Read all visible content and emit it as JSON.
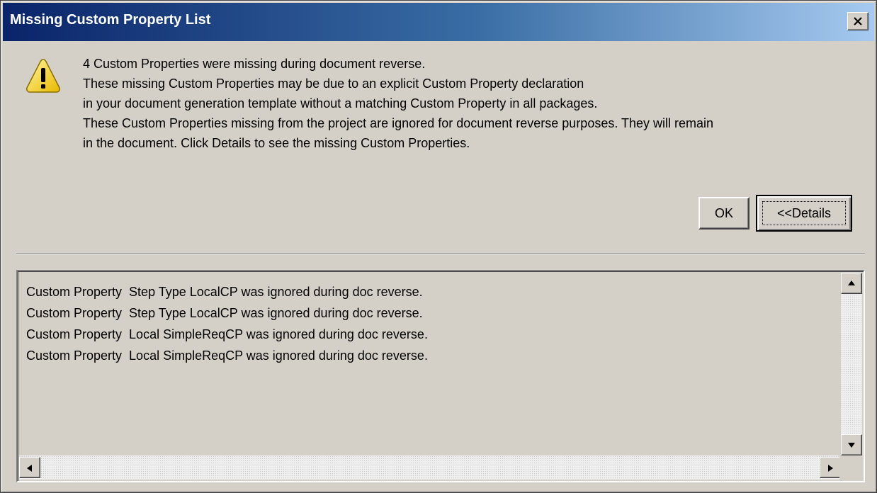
{
  "window": {
    "title": "Missing Custom Property List",
    "close_icon": "close-icon"
  },
  "message": {
    "icon": "warning-icon",
    "lines": [
      "4 Custom Properties were missing during document reverse.",
      "These missing Custom Properties may be due to an explicit Custom Property declaration",
      "in your document generation template without a matching Custom Property in all packages.",
      "These Custom Properties missing from the project are ignored for document reverse purposes.  They will remain",
      "in the document.  Click Details to see the missing Custom Properties."
    ]
  },
  "buttons": {
    "ok_label": "OK",
    "details_label": "<<Details"
  },
  "details_list": {
    "items": [
      "Custom Property  Step Type LocalCP was ignored during doc reverse.",
      "Custom Property  Step Type LocalCP was ignored during doc reverse.",
      "Custom Property  Local SimpleReqCP was ignored during doc reverse.",
      "Custom Property  Local SimpleReqCP was ignored during doc reverse."
    ]
  },
  "colors": {
    "title_gradient_start": "#0a246a",
    "title_gradient_end": "#a6caf0",
    "dialog_face": "#d4d0c8"
  }
}
